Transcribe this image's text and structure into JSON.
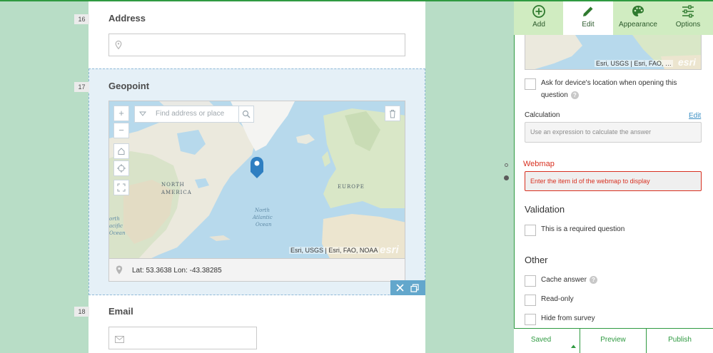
{
  "form": {
    "questions": [
      {
        "number": "16",
        "title": "Address"
      },
      {
        "number": "17",
        "title": "Geopoint"
      },
      {
        "number": "18",
        "title": "Email"
      }
    ],
    "geopoint": {
      "search_placeholder": "Find address or place",
      "attribution": "Esri, USGS | Esri, FAO, NOAA",
      "logo": "esri",
      "coordinates": "Lat: 53.3638 Lon: -43.38285",
      "labels": {
        "north_america_1": "NORTH",
        "north_america_2": "AMERICA",
        "europe": "EUROPE",
        "north_atlantic_1": "North",
        "north_atlantic_2": "Atlantic",
        "north_atlantic_3": "Ocean",
        "north_pacific_1": "orth",
        "north_pacific_2": "acific",
        "north_pacific_3": "Ocean"
      },
      "controls": {
        "zoom_in": "+",
        "zoom_out": "−"
      }
    }
  },
  "panel": {
    "toolbar": [
      {
        "label": "Add",
        "icon": "add-circle-icon"
      },
      {
        "label": "Edit",
        "icon": "pencil-icon",
        "active": true
      },
      {
        "label": "Appearance",
        "icon": "palette-icon"
      },
      {
        "label": "Options",
        "icon": "sliders-icon"
      }
    ],
    "map_attribution": "Esri, USGS | Esri, FAO, …",
    "map_logo": "esri",
    "ask_location_line1": "Ask for device's location when opening this",
    "ask_location_line2": "question",
    "calculation_label": "Calculation",
    "calculation_edit": "Edit",
    "calculation_placeholder": "Use an expression to calculate the answer",
    "webmap_label": "Webmap",
    "webmap_placeholder": "Enter the item id of the webmap to display",
    "validation_heading": "Validation",
    "required_label": "This is a required question",
    "other_heading": "Other",
    "cache_label": "Cache answer",
    "readonly_label": "Read-only",
    "hide_label": "Hide from survey",
    "help_glyph": "?"
  },
  "bottom": {
    "saved": "Saved",
    "preview": "Preview",
    "publish": "Publish"
  },
  "colors": {
    "background": "#b8ddc6",
    "accent_green": "#2f9a41",
    "toolbar_bg": "#d0ecc1",
    "error_red": "#d83020",
    "link_blue": "#3b8fc4",
    "pin_blue": "#2f7fc1"
  }
}
